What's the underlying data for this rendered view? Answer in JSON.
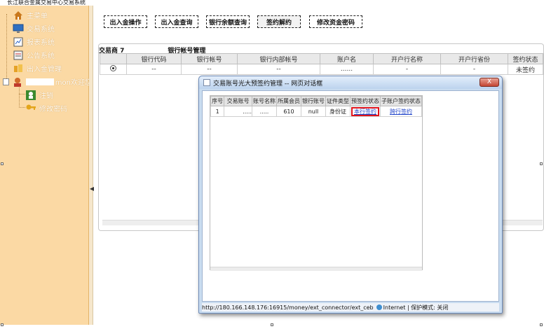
{
  "window": {
    "title": "长江联合金属交易中心交易系统"
  },
  "sidebar": {
    "items": [
      {
        "label": "主菜单",
        "icon": "home-icon"
      },
      {
        "label": "交易系统",
        "icon": "monitor-icon"
      },
      {
        "label": "报表系统",
        "icon": "report-icon"
      },
      {
        "label": "公告系统",
        "icon": "bulletin-icon"
      },
      {
        "label": "出入金管理",
        "icon": "money-icon"
      },
      {
        "label": "mon欢迎您",
        "icon": "user-icon"
      },
      {
        "label": "注销",
        "icon": "logout-icon"
      },
      {
        "label": "修改密码",
        "icon": "key-icon"
      }
    ]
  },
  "toolbar": {
    "buttons": [
      "出入金操作",
      "出入金查询",
      "银行余额查询",
      "签约解约",
      "修改资金密码"
    ]
  },
  "main": {
    "section_prefix": "交易商 7",
    "section_title": "银行帐号管理",
    "columns": [
      "银行代码",
      "银行帐号",
      "银行内部帐号",
      "账户名",
      "开户行名称",
      "开户行省份",
      "签约状态"
    ],
    "row": [
      "--",
      "--",
      "--",
      "......",
      "-",
      "-",
      "未签约"
    ]
  },
  "dialog": {
    "title": "交易账号光大预签约管理 -- 网页对话框",
    "close_label": "X",
    "columns": [
      "序号",
      "交易账号",
      "账号名称",
      "所属会员",
      "银行账号",
      "证件类型",
      "预签约状态",
      "子账户签约状态"
    ],
    "row": {
      "index": "1",
      "account": ".....",
      "name": ".....",
      "member": "610",
      "bank_account": "null",
      "id_type": "身份证",
      "presign_link": "本行签约",
      "sub_link": "跨行签约"
    },
    "status": {
      "url": "http://180.166.148.176:16915/money/ext_connector/ext_ceb",
      "zone": "Internet | 保护模式: 关闭"
    }
  },
  "colors": {
    "sidebar_bg": "#fbd9a4",
    "dialog_frame": "#c9dcf0",
    "link": "#1f43c9",
    "highlight": "#e0141b"
  }
}
